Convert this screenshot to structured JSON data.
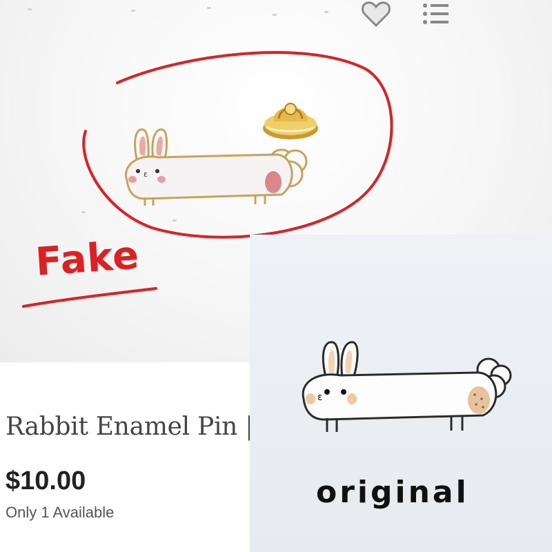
{
  "toolbar": {
    "favorite_icon": "heart-icon",
    "list_icon": "list-icon"
  },
  "annotations": {
    "fake_label": "Fake",
    "original_label": "original",
    "annotation_color": "#e02020"
  },
  "listing": {
    "title": "Rabbit Enamel Pin | F",
    "price": "$10.00",
    "availability": "Only 1 Available"
  }
}
